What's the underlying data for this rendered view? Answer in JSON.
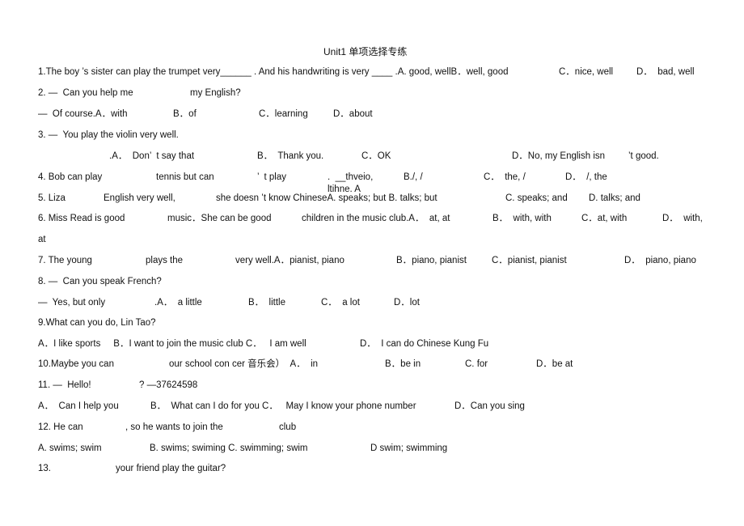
{
  "title": "Unit1 单项选择专练",
  "lines": {
    "q1": {
      "stem": "1.The boy ’s sister can play the trumpet very______ . And his handwriting is very ____ .A. good, wellB．well, good",
      "c": "C．nice, well",
      "d": "D．  bad, well"
    },
    "q2": {
      "stem_a": "2. —  Can you help me",
      "stem_b": "my English?",
      "reply": "—  Of course.A．with",
      "b": "B．of",
      "c": "C．learning",
      "d": "D．about"
    },
    "q3": {
      "stem": "3. —  You play the violin very well.",
      "a": ".A．  Don’  t say that",
      "b": "B．  Thank you.",
      "c": "C．OK",
      "d": "D．No, my English isn",
      "d2": "’t good."
    },
    "q4": {
      "stem_a": "4. Bob can play",
      "stem_b": "tennis but can",
      "stem_c": "’  t play",
      "stem_d": ".  __thveio,",
      "overlap": "ltihne. A",
      "b": "B./, /",
      "c": "C．  the, /",
      "d": "D．  /, the"
    },
    "q5": {
      "stem_a": "5. Liza",
      "stem_b": "English very well,",
      "stem_c": "she doesn ’t know ChineseA. speaks; but B. talks; but",
      "c": "C. speaks; and",
      "d": "D. talks; and"
    },
    "q6": {
      "stem_a": "6. Miss Read is good",
      "stem_b": "music．She can be good",
      "stem_c": "children in the music club.A．  at, at",
      "b": "B．  with, with",
      "c": "C．at, with",
      "d": "D．  with,",
      "d2": "at"
    },
    "q7": {
      "stem_a": "7. The young",
      "stem_b": "plays the",
      "stem_c": "very well.A．pianist, piano",
      "b": "B．piano, pianist",
      "c": "C．pianist, pianist",
      "d": "D．  piano, piano"
    },
    "q8": {
      "stem": "8. —  Can you speak French?",
      "reply": "—  Yes, but only",
      "a": ".A．  a little",
      "b": "B．  little",
      "c": "C．  a lot",
      "d": "D．lot"
    },
    "q9": {
      "stem": "9.What can you do, Lin Tao?",
      "ab": "A．I like sports     B．I want to join the music club C．   I am well",
      "d": "D．  I can do Chinese Kung Fu"
    },
    "q10": {
      "stem_a": "10.Maybe you can",
      "stem_b": "our school con cer 音乐会）  A．  in",
      "b": "B．be in",
      "c": "C. for",
      "d": "D．be at"
    },
    "q11": {
      "stem_a": "11. —  Hello!",
      "stem_b": "? —37624598",
      "a": "A．  Can I help you",
      "b": "B．  What can I do for you C．   May I know your phone number",
      "d": "D．Can you sing"
    },
    "q12": {
      "stem_a": "12. He can",
      "stem_b": ", so he wants to join the",
      "stem_c": "club",
      "a": "A. swims; swim",
      "bc": "B. swims; swiming C. swimming; swim",
      "d": "D swim; swimming"
    },
    "q13": {
      "stem_a": "13.",
      "stem_b": "your friend play the guitar?"
    }
  }
}
